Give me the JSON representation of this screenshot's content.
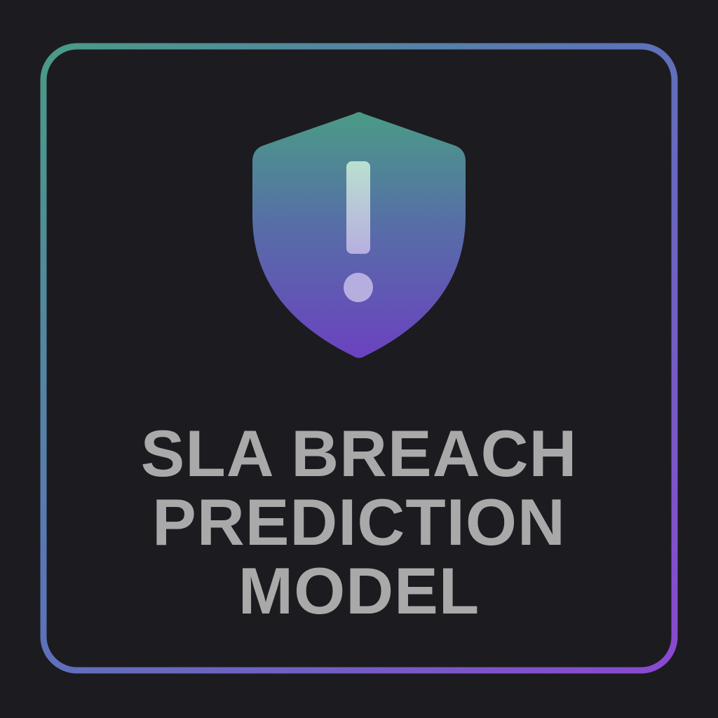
{
  "colors": {
    "background": "#1c1b20",
    "frame_gradient_start": "#4a9b86",
    "frame_gradient_end": "#8a48d0",
    "shield_gradient_top": "#4a9b86",
    "shield_gradient_bottom": "#6b42c0",
    "exclamation": "#b8dccf",
    "title_text": "#a9a9a9"
  },
  "icon": {
    "name": "shield-warning-icon"
  },
  "title": {
    "line1": "SLA BREACH",
    "line2": "PREDICTION",
    "line3": "MODEL"
  }
}
